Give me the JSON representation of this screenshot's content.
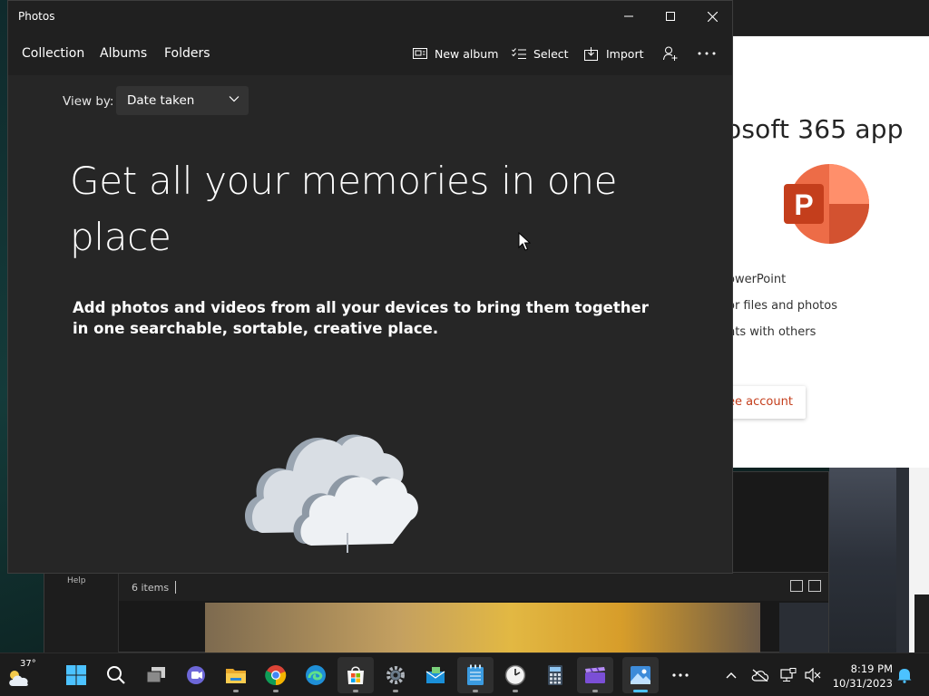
{
  "window": {
    "title": "Photos",
    "controls": {
      "minimize": "minimize",
      "maximize": "maximize",
      "close": "close"
    }
  },
  "nav": {
    "items": [
      {
        "label": "Collection"
      },
      {
        "label": "Albums"
      },
      {
        "label": "Folders"
      }
    ],
    "commands": [
      {
        "label": "New album",
        "icon": "new-album-icon"
      },
      {
        "label": "Select",
        "icon": "select-icon"
      },
      {
        "label": "Import",
        "icon": "import-icon"
      }
    ]
  },
  "viewby": {
    "label": "View by:",
    "selected": "Date taken"
  },
  "main": {
    "headline": "Get all your memories in one place",
    "subtext": "Add photos and videos from all your devices to bring them together in one searchable, sortable, creative place."
  },
  "background_explorer": {
    "help_label": "Help",
    "item_count": "6 items"
  },
  "ms365": {
    "title": "osoft 365 app",
    "lines": [
      "owerPoint",
      "or files and photos",
      "nts with others"
    ],
    "button_label": "ee account"
  },
  "taskbar": {
    "weather_temp": "37°",
    "apps": [
      "start",
      "search",
      "task-view",
      "teams-chat",
      "file-explorer",
      "chrome",
      "edge",
      "microsoft-store",
      "settings",
      "mail",
      "notepad",
      "clock",
      "calculator",
      "clipchamp",
      "photos",
      "more"
    ],
    "time": "8:19 PM",
    "date": "10/31/2023"
  },
  "colors": {
    "window_bg": "#262626",
    "titlebar_bg": "#202020",
    "accent": "#4cc2ff",
    "powerpoint": "#c43e1c"
  }
}
